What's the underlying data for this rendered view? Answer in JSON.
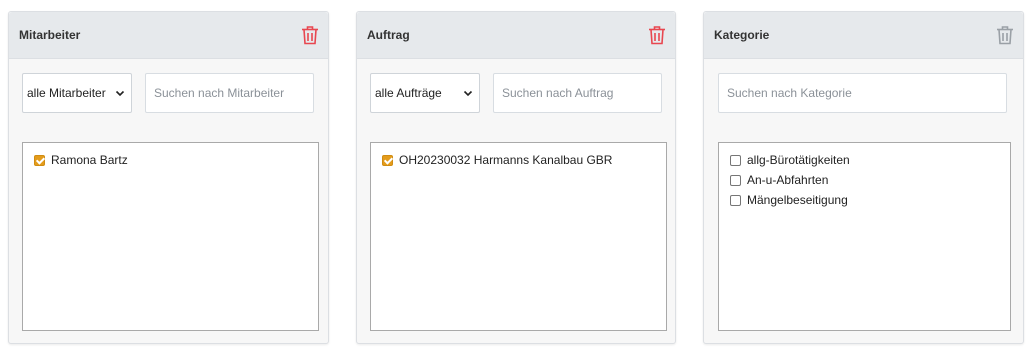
{
  "panels": [
    {
      "title": "Mitarbeiter",
      "select_value": "alle Mitarbeiter",
      "search_placeholder": "Suchen nach Mitarbeiter",
      "items": [
        {
          "label": "Ramona Bartz",
          "checked": true
        }
      ],
      "trash_active": true
    },
    {
      "title": "Auftrag",
      "select_value": "alle Aufträge",
      "search_placeholder": "Suchen nach Auftrag",
      "items": [
        {
          "label": "OH20230032 Harmanns Kanalbau GBR",
          "checked": true
        }
      ],
      "trash_active": true
    },
    {
      "title": "Kategorie",
      "search_placeholder": "Suchen nach Kategorie",
      "items": [
        {
          "label": "allg-Bürotätigkeiten",
          "checked": false
        },
        {
          "label": "An-u-Abfahrten",
          "checked": false
        },
        {
          "label": "Mängelbeseitigung",
          "checked": false
        }
      ],
      "trash_active": false
    }
  ],
  "icons": {
    "trash": "trash-icon",
    "chevron": "chevron-down-icon"
  },
  "colors": {
    "trash_active": "#e8464f",
    "trash_inactive": "#9aa0a6",
    "checkbox_checked": "#e49c1b",
    "header_bg": "#e6e9ec"
  }
}
